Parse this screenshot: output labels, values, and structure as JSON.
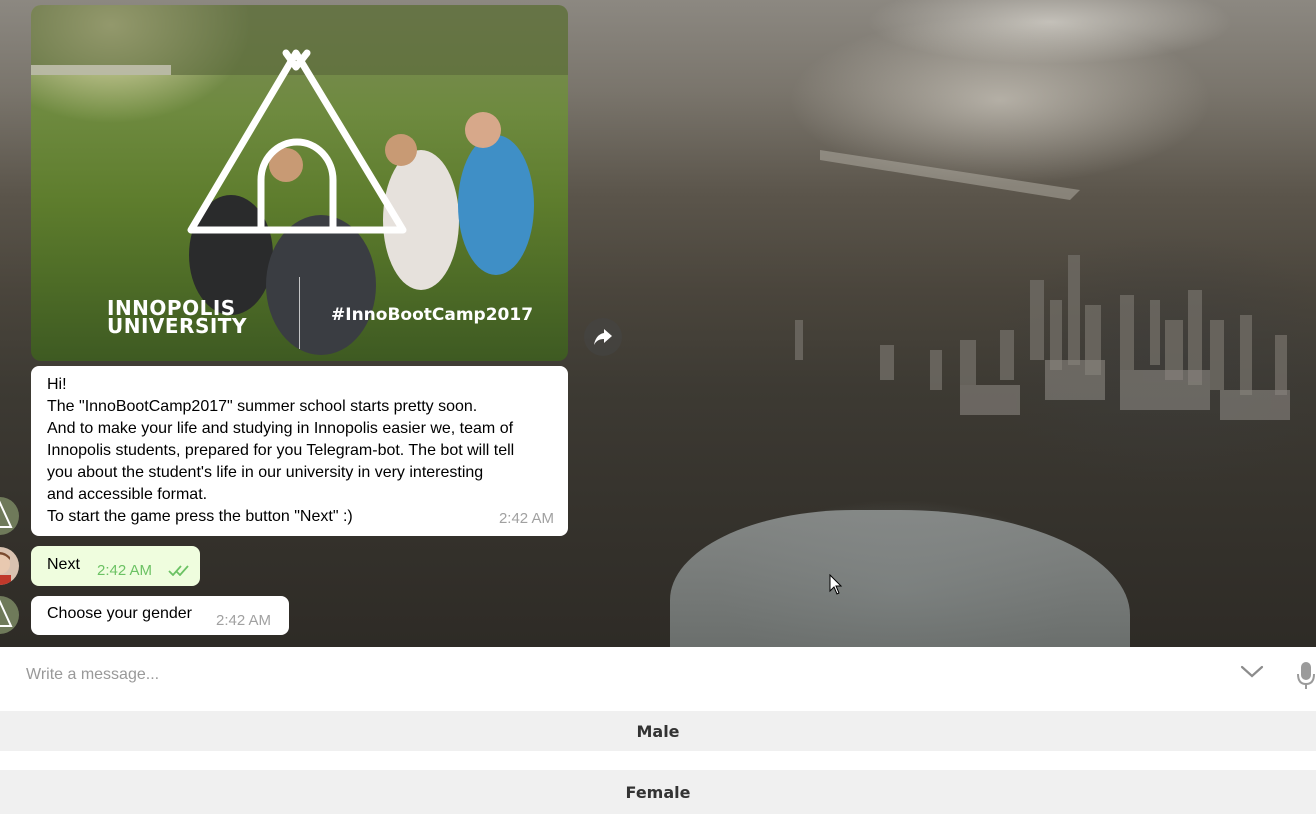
{
  "media": {
    "logo_line1": "INNOPOLIS",
    "logo_line2": "UNIVERSITY",
    "hashtag": "#InnoBootCamp2017"
  },
  "messages": {
    "bot_intro": {
      "lines": [
        "Hi!",
        "The \"InnoBootCamp2017\" summer school starts pretty soon.",
        "And to make your life and studying in Innopolis easier we, team of",
        "Innopolis students, prepared for you Telegram-bot. The bot will tell",
        "you about the student's life in our university in very interesting",
        "and accessible format.",
        "To start the game press the button \"Next\" :)"
      ],
      "time": "2:42 AM"
    },
    "user_next": {
      "text": "Next",
      "time": "2:42 AM",
      "status_icon": "double-check-icon"
    },
    "bot_gender": {
      "text": "Choose your gender",
      "time": "2:42 AM"
    }
  },
  "composer": {
    "placeholder": "Write a message..."
  },
  "keyboard": {
    "buttons": [
      "Male",
      "Female"
    ]
  },
  "colors": {
    "outgoing_bubble": "#effdde",
    "outgoing_time": "#6cc264",
    "incoming_time": "#a1a1a1",
    "keyboard_button": "#f0f0f0"
  }
}
